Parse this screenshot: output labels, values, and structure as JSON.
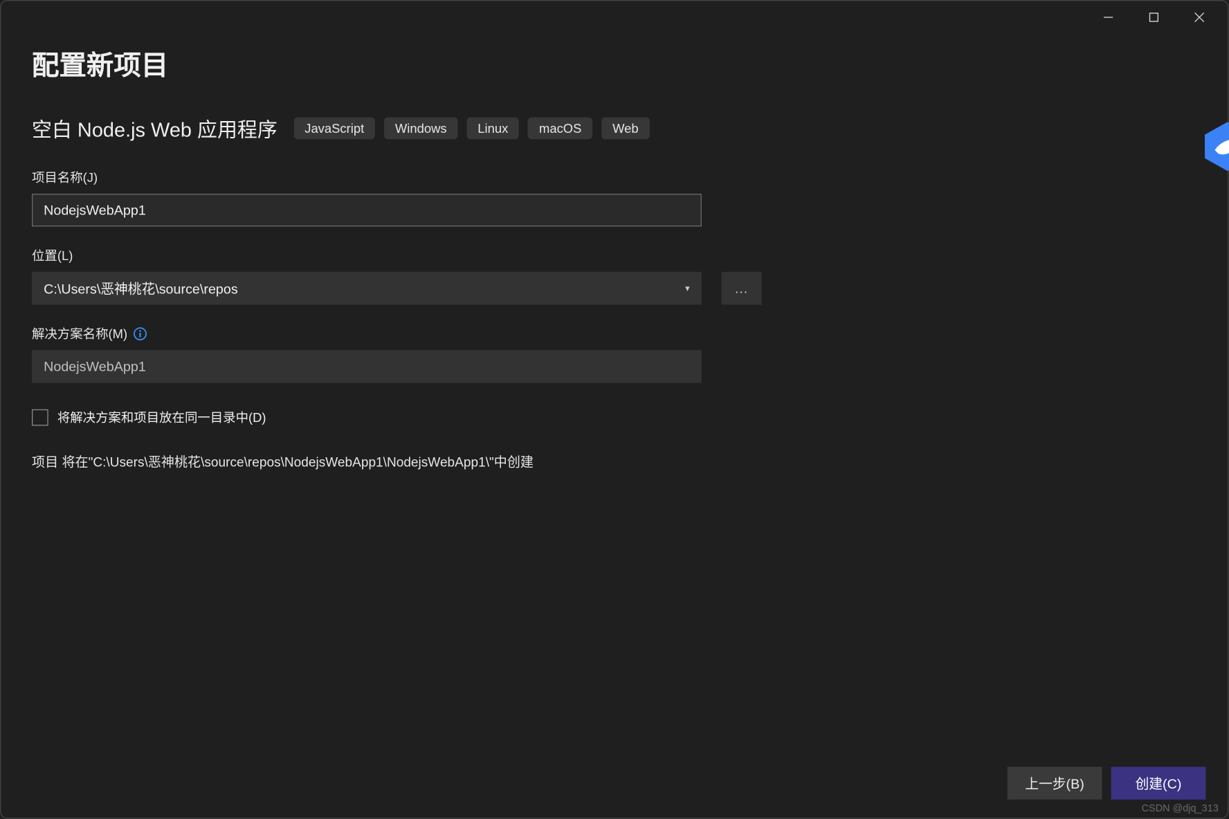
{
  "header": {
    "title": "配置新项目",
    "subtitle": "空白 Node.js Web 应用程序",
    "tags": [
      "JavaScript",
      "Windows",
      "Linux",
      "macOS",
      "Web"
    ]
  },
  "fields": {
    "project_name": {
      "label": "项目名称(J)",
      "value": "NodejsWebApp1"
    },
    "location": {
      "label": "位置(L)",
      "value": "C:\\Users\\恶神桃花\\source\\repos",
      "browse_label": "..."
    },
    "solution_name": {
      "label": "解决方案名称(M)",
      "value": "NodejsWebApp1"
    },
    "same_dir_checkbox": {
      "checked": false,
      "label": "将解决方案和项目放在同一目录中(D)"
    }
  },
  "summary": "项目 将在\"C:\\Users\\恶神桃花\\source\\repos\\NodejsWebApp1\\NodejsWebApp1\\\"中创建",
  "footer": {
    "back_label": "上一步(B)",
    "create_label": "创建(C)"
  },
  "watermark": "CSDN @djq_313",
  "colors": {
    "background": "#1f1f1f",
    "accent": "#3b3282",
    "info_icon": "#3794ff",
    "badge": "#3b82f6"
  }
}
